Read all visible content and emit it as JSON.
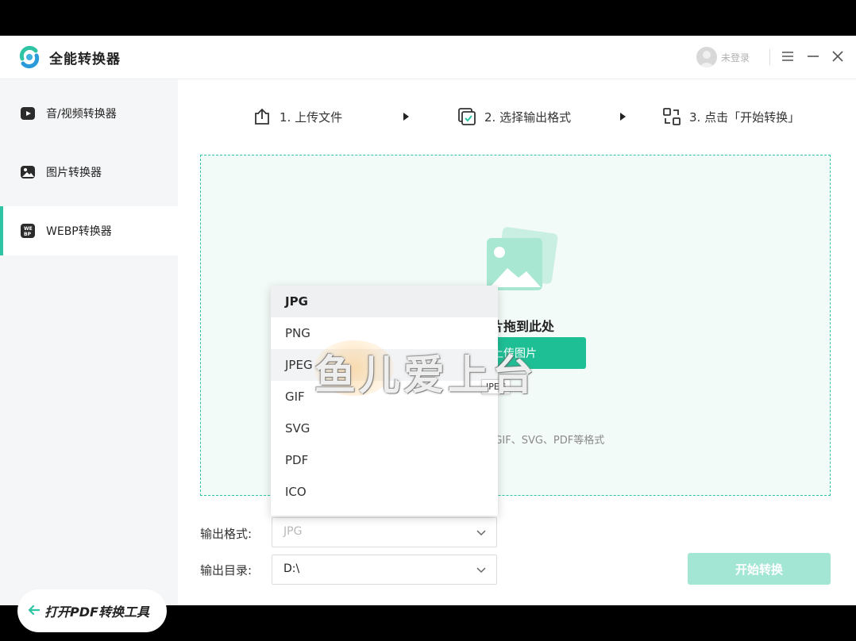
{
  "app": {
    "title": "全能转换器",
    "login_text": "未登录"
  },
  "colors": {
    "accent": "#2fc4a3",
    "button": "#1fbf96",
    "button_disabled": "#a4e6d4"
  },
  "sidebar": {
    "items": [
      {
        "label": "音/视频转换器",
        "icon": "video-icon"
      },
      {
        "label": "图片转换器",
        "icon": "image-icon"
      },
      {
        "label": "WEBP转换器",
        "icon": "webp-icon",
        "active": true
      }
    ],
    "pdf_tool_label": "打开PDF转换工具"
  },
  "steps": [
    {
      "label": "1. 上传文件",
      "icon": "upload-icon"
    },
    {
      "label": "2. 选择输出格式",
      "icon": "checkbox-icon"
    },
    {
      "label": "3. 点击「开始转换」",
      "icon": "convert-icon"
    }
  ],
  "dropzone": {
    "text": "图片拖到此处",
    "upload_button": "上传图片",
    "support_text": "PNG、JPEG、GIF、SVG、PDF等格式"
  },
  "form": {
    "format_label": "输出格式:",
    "format_value": "JPG",
    "dir_label": "输出目录:",
    "dir_value": "D:\\",
    "start_button": "开始转换"
  },
  "dropdown": {
    "options": [
      "JPG",
      "PNG",
      "JPEG",
      "GIF",
      "SVG",
      "PDF",
      "ICO"
    ],
    "selected": "JPG",
    "hovered": "JPEG",
    "tooltip": "JPEG"
  },
  "watermark": "鱼儿爱上台"
}
